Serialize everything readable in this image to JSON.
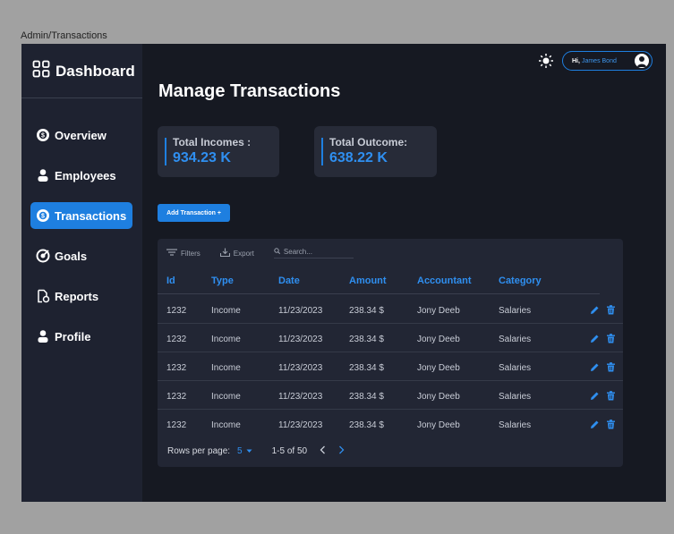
{
  "frame_label": "Admin/Transactions",
  "sidebar": {
    "brand": "Dashboard",
    "items": [
      {
        "label": "Overview",
        "icon": "overview-icon",
        "active": false
      },
      {
        "label": "Employees",
        "icon": "employee-icon",
        "active": false
      },
      {
        "label": "Transactions",
        "icon": "transactions-icon",
        "active": true
      },
      {
        "label": "Goals",
        "icon": "goals-icon",
        "active": false
      },
      {
        "label": "Reports",
        "icon": "reports-icon",
        "active": false
      },
      {
        "label": "Profile",
        "icon": "profile-icon",
        "active": false
      }
    ]
  },
  "header": {
    "greeting": "Hi,",
    "user_name": "James Bond"
  },
  "page_title": "Manage Transactions",
  "stats": {
    "incomes_label": "Total Incomes :",
    "incomes_value": "934.23 K",
    "outcome_label": "Total Outcome:",
    "outcome_value": "638.22 K"
  },
  "add_button": "Add Transaction  +",
  "toolbar": {
    "filters": "Filters",
    "export": "Export",
    "search_placeholder": "Search..."
  },
  "table": {
    "columns": [
      "Id",
      "Type",
      "Date",
      "Amount",
      "Accountant",
      "Category"
    ],
    "rows": [
      [
        "1232",
        "Income",
        "11/23/2023",
        "238.34 $",
        "Jony Deeb",
        "Salaries"
      ],
      [
        "1232",
        "Income",
        "11/23/2023",
        "238.34 $",
        "Jony Deeb",
        "Salaries"
      ],
      [
        "1232",
        "Income",
        "11/23/2023",
        "238.34 $",
        "Jony Deeb",
        "Salaries"
      ],
      [
        "1232",
        "Income",
        "11/23/2023",
        "238.34 $",
        "Jony Deeb",
        "Salaries"
      ],
      [
        "1232",
        "Income",
        "11/23/2023",
        "238.34 $",
        "Jony Deeb",
        "Salaries"
      ]
    ]
  },
  "pagination": {
    "rows_label": "Rows per page:",
    "rows_value": "5",
    "range": "1-5 of 50"
  },
  "colors": {
    "accent": "#1e7fe0",
    "sidebar_bg": "#1e2230",
    "main_bg": "#161922",
    "panel_bg": "#222634"
  }
}
